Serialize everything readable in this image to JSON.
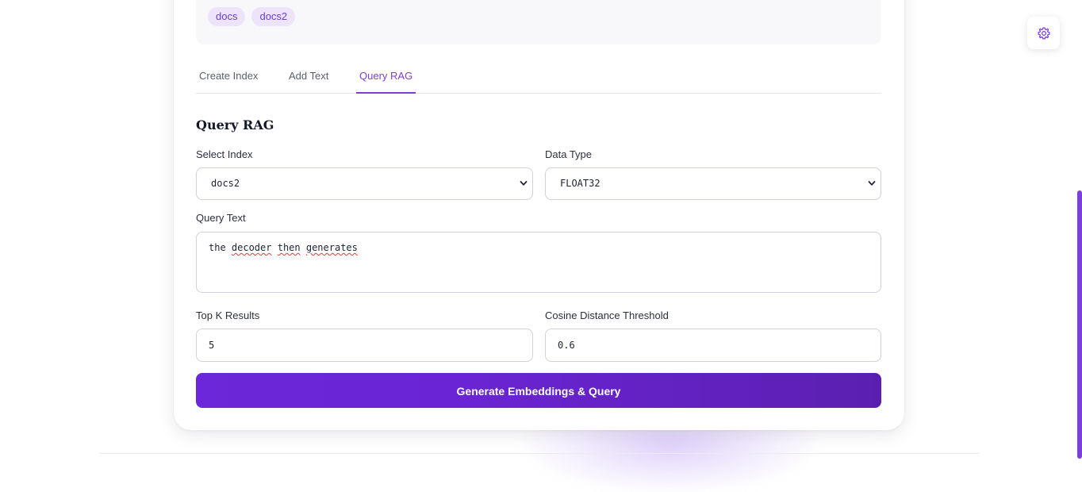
{
  "tags": [
    "docs",
    "docs2"
  ],
  "tabs": [
    {
      "label": "Create Index",
      "active": false
    },
    {
      "label": "Add Text",
      "active": false
    },
    {
      "label": "Query RAG",
      "active": true
    }
  ],
  "query_rag": {
    "title": "Query RAG",
    "select_index": {
      "label": "Select Index",
      "value": "docs2"
    },
    "data_type": {
      "label": "Data Type",
      "value": "FLOAT32"
    },
    "query_text": {
      "label": "Query Text",
      "value_parts": [
        "the ",
        "decoder",
        " ",
        "then",
        " ",
        "generates"
      ]
    },
    "top_k": {
      "label": "Top K Results",
      "value": "5"
    },
    "threshold": {
      "label": "Cosine Distance Threshold",
      "value": "0.6"
    },
    "submit_label": "Generate Embeddings & Query"
  },
  "icons": {
    "settings": "gear-icon",
    "select_chevron": "chevron-down-icon"
  },
  "colors": {
    "accent": "#7c3fd9",
    "button_start": "#6b27d9",
    "button_end": "#5b1fb0",
    "tag_bg": "#ede3fb",
    "tag_text": "#6d3fc7"
  }
}
